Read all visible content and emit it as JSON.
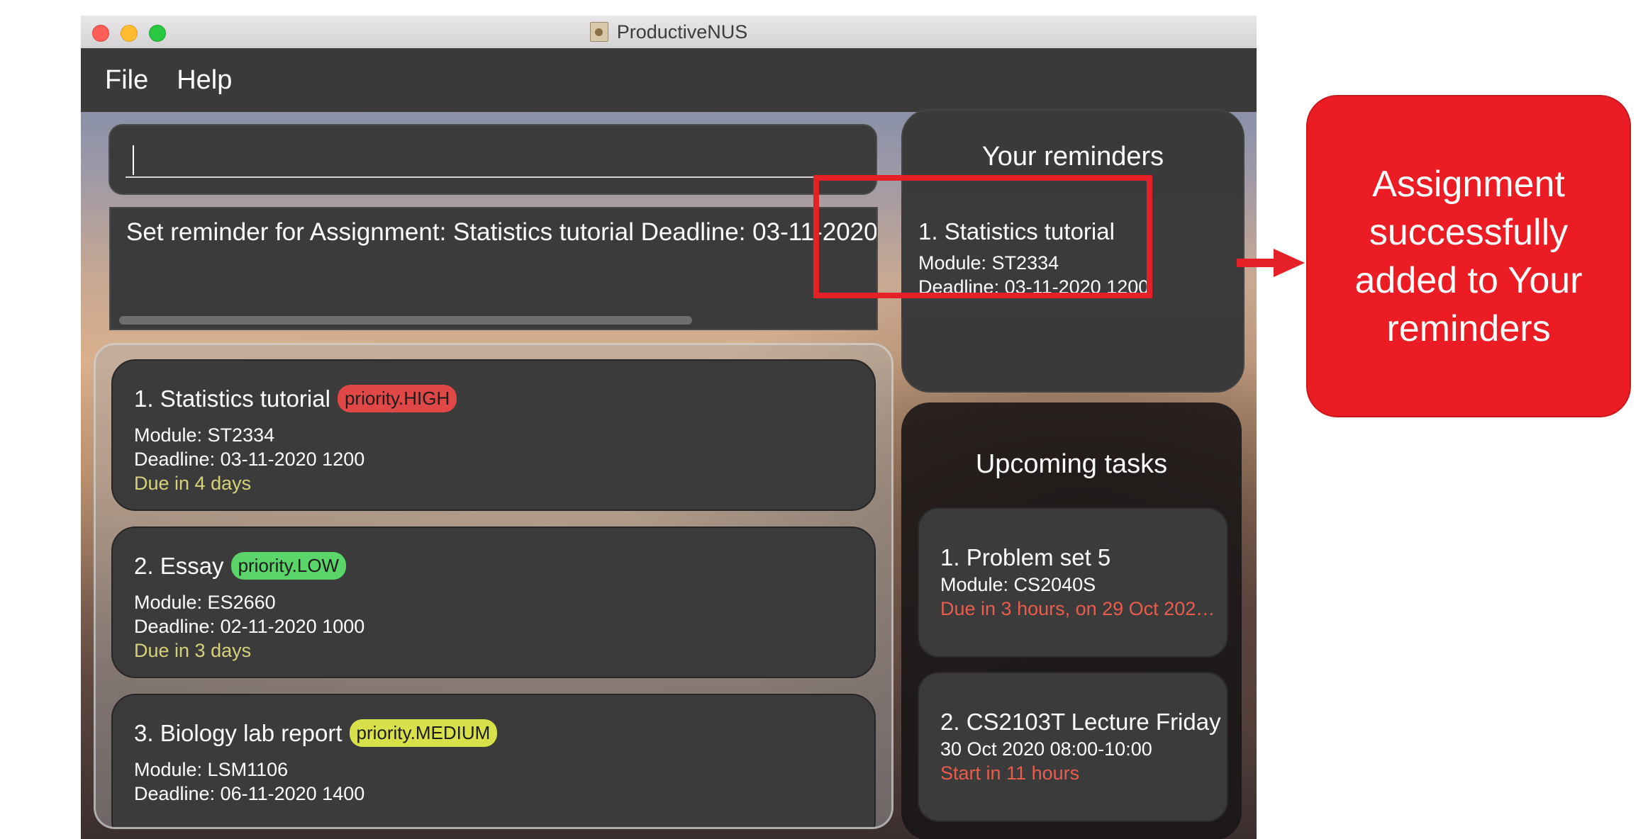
{
  "window": {
    "title": "ProductiveNUS"
  },
  "menu": {
    "file": "File",
    "help": "Help"
  },
  "command": {
    "value": ""
  },
  "result": {
    "text": "Set reminder for Assignment: Statistics tutorial Deadline: 03-11-2020 12"
  },
  "assignments": [
    {
      "title": "1.  Statistics tutorial",
      "priority": "priority.HIGH",
      "module": "Module: ST2334",
      "deadline": "Deadline: 03-11-2020 1200",
      "due": "Due in 4 days"
    },
    {
      "title": "2.  Essay",
      "priority": "priority.LOW",
      "module": "Module: ES2660",
      "deadline": "Deadline: 02-11-2020 1000",
      "due": "Due in 3 days"
    },
    {
      "title": "3.  Biology lab report",
      "priority": "priority.MEDIUM",
      "module": "Module: LSM1106",
      "deadline": "Deadline: 06-11-2020 1400"
    }
  ],
  "reminders": {
    "heading": "Your reminders",
    "items": [
      {
        "title": "1.  Statistics tutorial",
        "module": "Module: ST2334",
        "deadline": "Deadline: 03-11-2020 1200"
      }
    ]
  },
  "upcoming": {
    "heading": "Upcoming tasks",
    "items": [
      {
        "title": "1.  Problem set 5",
        "line2": "Module: CS2040S",
        "line3": "Due in 3 hours, on 29 Oct 2020 2..."
      },
      {
        "title": "2.  CS2103T Lecture Friday",
        "line2": "30 Oct 2020 08:00-10:00",
        "line3": "Start in 11 hours"
      }
    ]
  },
  "annotation": {
    "text": "Assignment successfully added to Your reminders"
  },
  "colors": {
    "highlight": "#e52027",
    "callout": "#ec1c24",
    "priority_high": "#e04848",
    "priority_low": "#5bd46a",
    "priority_medium": "#d8e04a",
    "due_soon": "#d6d17a",
    "due_urgent": "#e85d4d"
  }
}
